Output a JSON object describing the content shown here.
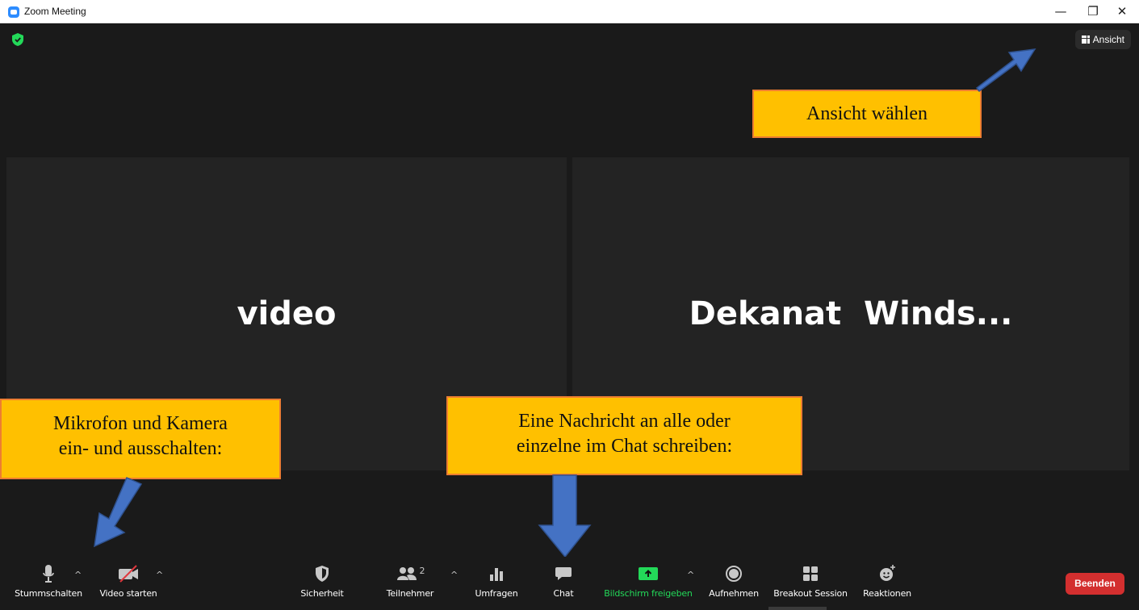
{
  "window": {
    "title": "Zoom Meeting",
    "controls": {
      "minimize": "—",
      "restore": "❐",
      "close": "✕"
    }
  },
  "top": {
    "view_label": "Ansicht"
  },
  "tiles": [
    {
      "name": "video"
    },
    {
      "name": "Dekanat  Winds..."
    }
  ],
  "callouts": {
    "view": "Ansicht wählen",
    "mic_line1": "Mikrofon und Kamera",
    "mic_line2": "ein- und ausschalten:",
    "chat_line1": "Eine Nachricht an alle oder",
    "chat_line2": "einzelne im Chat schreiben:"
  },
  "toolbar": {
    "mute": "Stummschalten",
    "video": "Video starten",
    "security": "Sicherheit",
    "participants": "Teilnehmer",
    "participants_count": "2",
    "polls": "Umfragen",
    "chat": "Chat",
    "share": "Bildschirm freigeben",
    "record": "Aufnehmen",
    "breakout": "Breakout Session",
    "reactions": "Reaktionen",
    "end": "Beenden",
    "caret": "^"
  },
  "colors": {
    "background": "#1a1a1a",
    "tile": "#232323",
    "callout_fill": "#ffc000",
    "callout_border": "#ed7d31",
    "arrow": "#4472c4",
    "share_green": "#23d959",
    "end_red": "#d32f2f"
  }
}
